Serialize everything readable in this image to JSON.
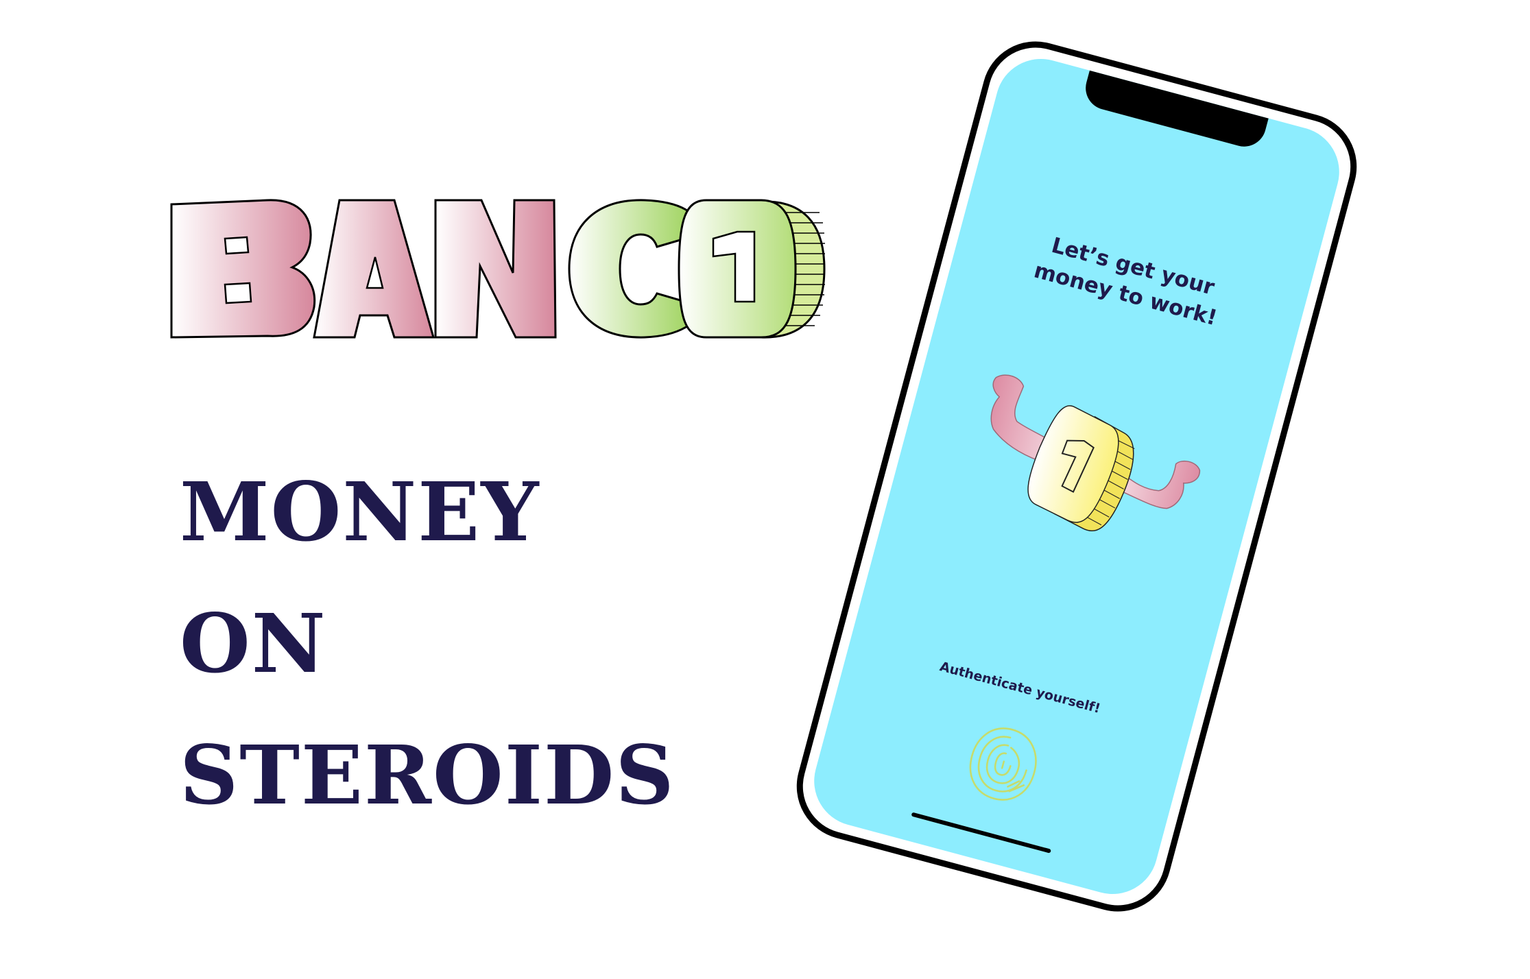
{
  "brand": {
    "logo_text": "BANCO",
    "logo_coin_digit": "1",
    "tagline_lines": [
      "MONEY",
      "ON",
      "STEROIDS"
    ]
  },
  "phone_screen": {
    "headline": "Let’s get your\nmoney to work!",
    "mascot_coin_digit": "1",
    "auth_label": "Authenticate yourself!",
    "auth_icon": "fingerprint-icon"
  },
  "colors": {
    "background": "#ffffff",
    "navy_text": "#1f1a4c",
    "screen_blue": "#8dedfe",
    "logo_pink": "#d6879c",
    "logo_green": "#96cf4f",
    "coin_yellow": "#fbf380",
    "fingerprint_green": "#c6dc6c"
  }
}
